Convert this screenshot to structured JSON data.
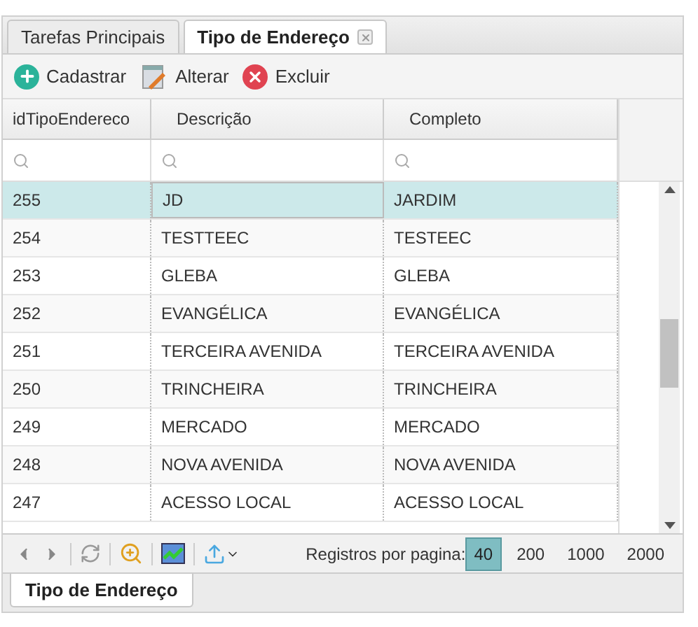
{
  "tabs": [
    {
      "label": "Tarefas Principais",
      "selected": false,
      "closable": false
    },
    {
      "label": "Tipo de Endereço",
      "selected": true,
      "closable": true
    }
  ],
  "toolbar": [
    {
      "kind": "add",
      "label": "Cadastrar"
    },
    {
      "kind": "edit",
      "label": "Alterar"
    },
    {
      "kind": "delete",
      "label": "Excluir"
    }
  ],
  "table": {
    "columns": [
      "idTipoEndereco",
      "Descrição",
      "Completo"
    ],
    "rows": [
      {
        "cells": [
          "255",
          "JD",
          "JARDIM"
        ],
        "selected": true
      },
      {
        "cells": [
          "254",
          "TESTTEEC",
          "TESTEEC"
        ],
        "selected": false
      },
      {
        "cells": [
          "253",
          "GLEBA",
          "GLEBA"
        ],
        "selected": false
      },
      {
        "cells": [
          "252",
          "EVANGÉLICA",
          "EVANGÉLICA"
        ],
        "selected": false
      },
      {
        "cells": [
          "251",
          "TERCEIRA AVENIDA",
          "TERCEIRA AVENIDA"
        ],
        "selected": false
      },
      {
        "cells": [
          "250",
          "TRINCHEIRA",
          "TRINCHEIRA"
        ],
        "selected": false
      },
      {
        "cells": [
          "249",
          "MERCADO",
          "MERCADO"
        ],
        "selected": false
      },
      {
        "cells": [
          "248",
          "NOVA AVENIDA",
          "NOVA AVENIDA"
        ],
        "selected": false
      },
      {
        "cells": [
          "247",
          "ACESSO LOCAL",
          "ACESSO LOCAL"
        ],
        "selected": false
      }
    ]
  },
  "pager": {
    "label": "Registros por pagina:",
    "sizes": [
      {
        "label": "40",
        "selected": true
      },
      {
        "label": "200",
        "selected": false
      },
      {
        "label": "1000",
        "selected": false
      },
      {
        "label": "2000",
        "selected": false
      }
    ]
  },
  "bottom_tab": {
    "label": "Tipo de Endereço"
  }
}
